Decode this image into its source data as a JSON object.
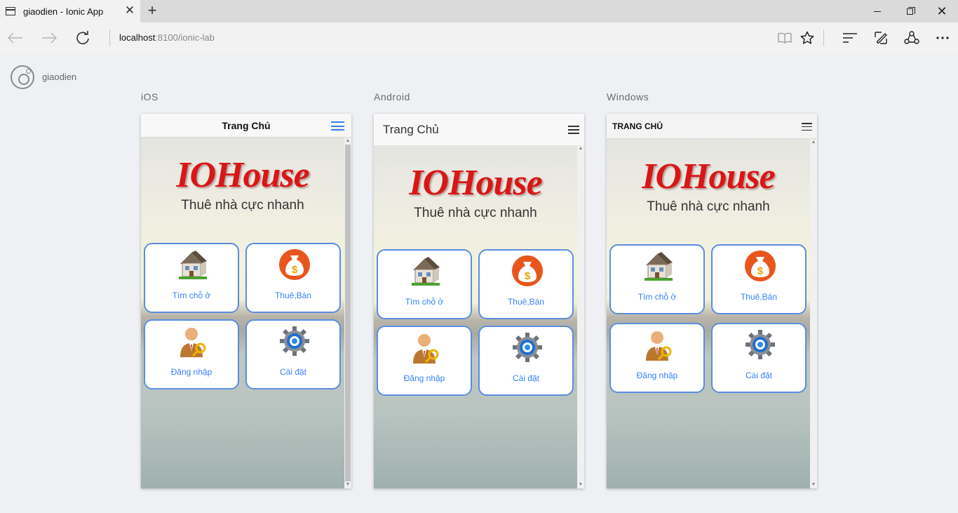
{
  "browser": {
    "tab_title": "giaodien - Ionic App",
    "tab_close": "✕",
    "new_tab": "+",
    "address_host": "localhost",
    "address_path": ":8100/ionic-lab",
    "window_minimize": "—",
    "window_close": "✕"
  },
  "lab": {
    "app_name": "giaodien"
  },
  "platforms": [
    {
      "label": "iOS",
      "header_title": "Trang Chủ",
      "brand": "IOHouse",
      "tagline": "Thuê nhà cực nhanh",
      "tiles": [
        "Tìm chỗ ở",
        "Thuê,Bán",
        "Đăng nhập",
        "Cài đặt"
      ]
    },
    {
      "label": "Android",
      "header_title": "Trang Chủ",
      "brand": "IOHouse",
      "tagline": "Thuê nhà cực nhanh",
      "tiles": [
        "Tìm chỗ ở",
        "Thuê,Bán",
        "Đăng nhập",
        "Cài đặt"
      ]
    },
    {
      "label": "Windows",
      "header_title": "TRANG CHỦ",
      "brand": "IOHouse",
      "tagline": "Thuê nhà cực nhanh",
      "tiles": [
        "Tìm chỗ ở",
        "Thuê,Bán",
        "Đăng nhập",
        "Cài đặt"
      ]
    }
  ],
  "colors": {
    "accent": "#3880ff",
    "tile_border": "#5b8de0",
    "brand_red": "#d91616",
    "money_bag": "#e8561d"
  }
}
